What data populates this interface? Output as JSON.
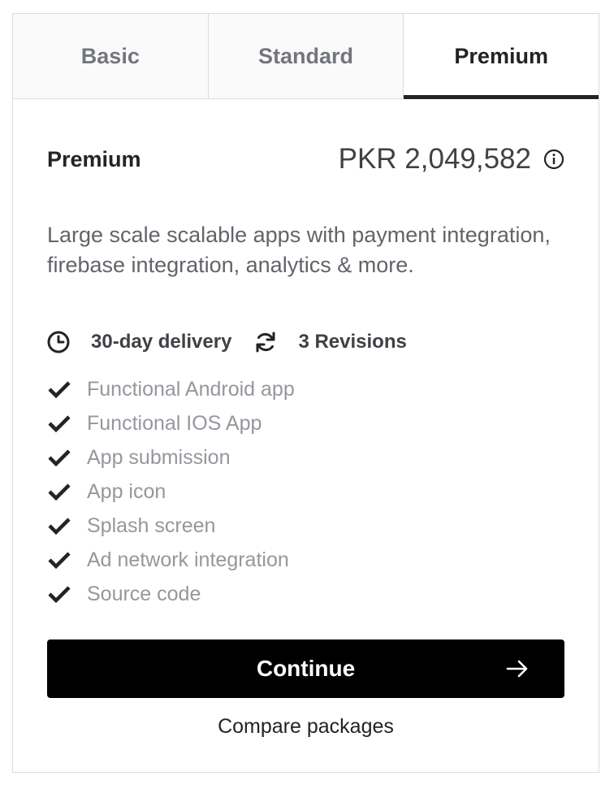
{
  "tabs": [
    {
      "label": "Basic",
      "active": false
    },
    {
      "label": "Standard",
      "active": false
    },
    {
      "label": "Premium",
      "active": true
    }
  ],
  "package": {
    "name": "Premium",
    "price": "PKR 2,049,582",
    "price_info_icon": "info-icon",
    "description": "Large scale scalable apps with payment integration, firebase integration, analytics & more.",
    "delivery": {
      "icon": "clock-icon",
      "label": "30-day delivery"
    },
    "revisions": {
      "icon": "refresh-icon",
      "label": "3 Revisions"
    },
    "features": [
      {
        "label": "Functional Android app",
        "icon": "check-icon"
      },
      {
        "label": "Functional IOS App",
        "icon": "check-icon"
      },
      {
        "label": "App submission",
        "icon": "check-icon"
      },
      {
        "label": "App icon",
        "icon": "check-icon"
      },
      {
        "label": "Splash screen",
        "icon": "check-icon"
      },
      {
        "label": "Ad network integration",
        "icon": "check-icon"
      },
      {
        "label": "Source code",
        "icon": "check-icon"
      }
    ]
  },
  "actions": {
    "continue_label": "Continue",
    "continue_icon": "arrow-right-icon",
    "compare_label": "Compare packages"
  },
  "colors": {
    "accent": "#000000",
    "text": "#222325",
    "muted": "#95979d",
    "border": "#dadbdd"
  }
}
